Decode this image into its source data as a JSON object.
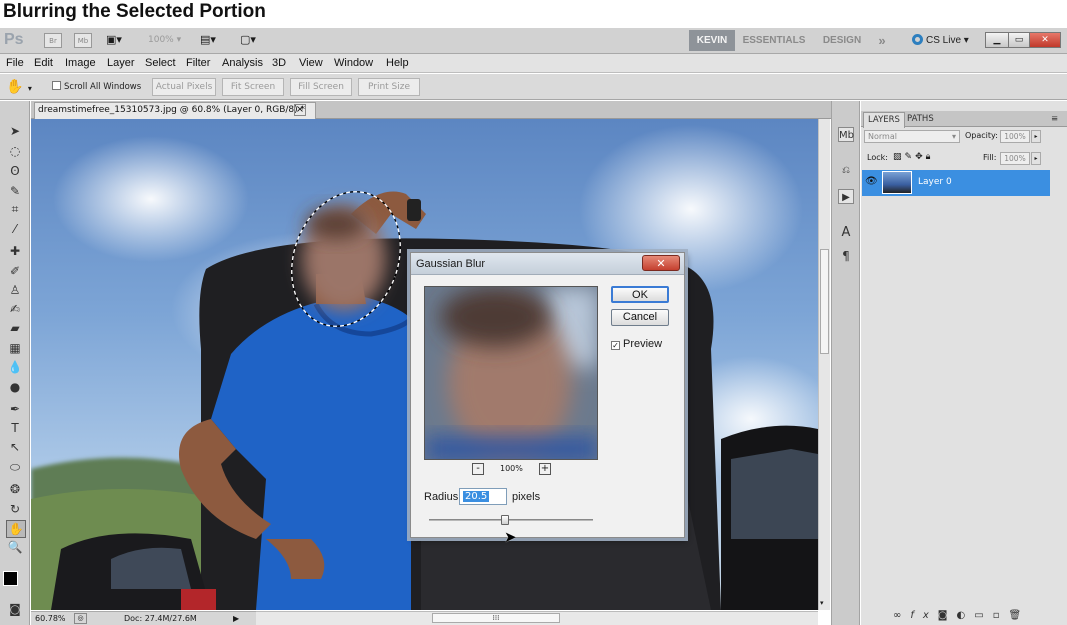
{
  "slide_title": "Blurring the Selected Portion",
  "appbar": {
    "logo": "Ps",
    "icon_br": "Br",
    "icon_mb": "Mb",
    "zoom": "100%",
    "workspaces": [
      "KEVIN",
      "ESSENTIALS",
      "DESIGN"
    ],
    "more": "»",
    "cs_live": "CS Live",
    "win_close": "✕"
  },
  "menu": [
    "File",
    "Edit",
    "Image",
    "Layer",
    "Select",
    "Filter",
    "Analysis",
    "3D",
    "View",
    "Window",
    "Help"
  ],
  "options": {
    "scroll_all": "Scroll All Windows",
    "buttons": [
      "Actual Pixels",
      "Fit Screen",
      "Fill Screen",
      "Print Size"
    ]
  },
  "document": {
    "tab_title": "dreamstimefree_15310573.jpg @ 60.8% (Layer 0, RGB/8) *",
    "tab_close": "×"
  },
  "status": {
    "zoom": "60.78%",
    "doc_info": "Doc: 27.4M/27.6M"
  },
  "layers": {
    "tabs": [
      "LAYERS",
      "PATHS"
    ],
    "blend_mode": "Normal",
    "opacity_label": "Opacity:",
    "opacity_value": "100%",
    "lock_label": "Lock:",
    "fill_label": "Fill:",
    "fill_value": "100%",
    "layer_name": "Layer 0"
  },
  "dialog": {
    "title": "Gaussian Blur",
    "ok": "OK",
    "cancel": "Cancel",
    "preview_label": "Preview",
    "preview_checked": true,
    "zoom_minus": "-",
    "zoom_plus": "+",
    "zoom_value": "100%",
    "radius_label": "Radius:",
    "radius_value": "20.5",
    "radius_unit": "pixels",
    "slider_fraction": 0.46
  },
  "colors": {
    "accent": "#3b8fe1",
    "shirt": "#1f63c6",
    "sky": "#6a93cc"
  }
}
